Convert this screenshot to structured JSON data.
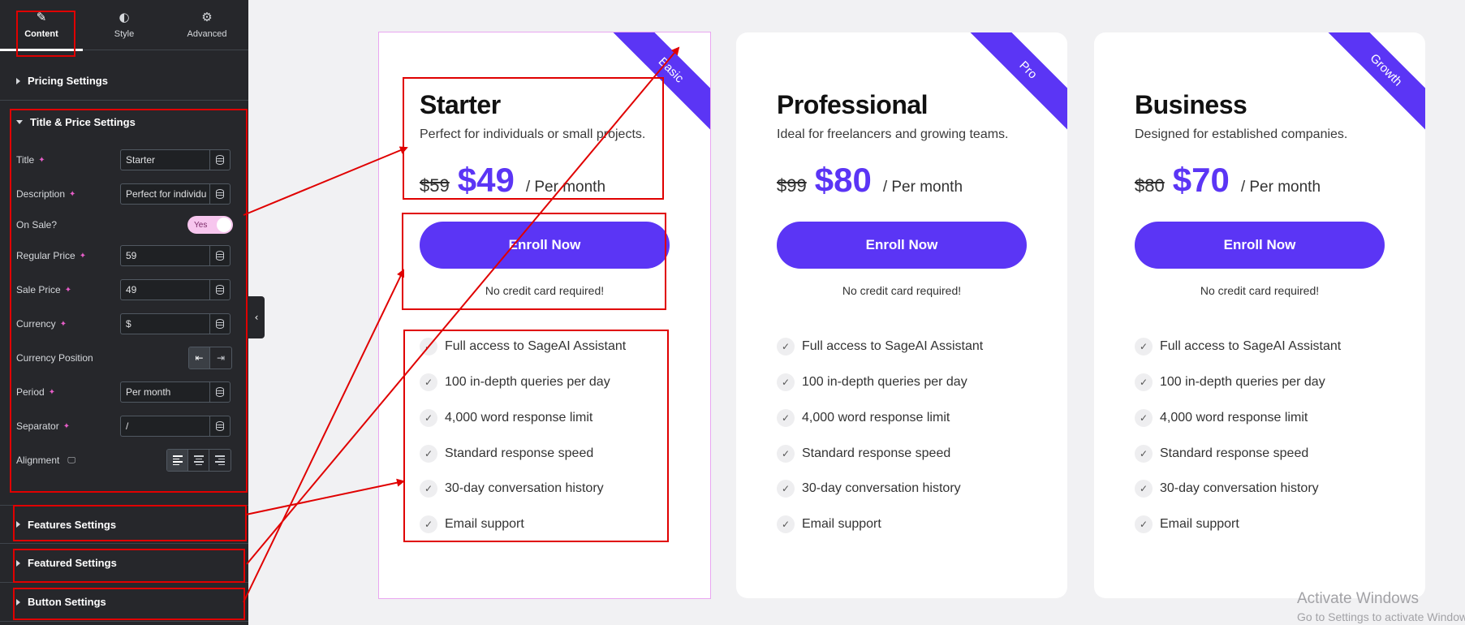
{
  "panel": {
    "tabs": [
      {
        "label": "Content",
        "icon": "pencil-icon"
      },
      {
        "label": "Style",
        "icon": "contrast-icon"
      },
      {
        "label": "Advanced",
        "icon": "gear-icon"
      }
    ],
    "sections": {
      "pricing": "Pricing Settings",
      "title_price": "Title & Price Settings",
      "features": "Features Settings",
      "featured": "Featured Settings",
      "button": "Button Settings"
    },
    "controls": {
      "title": {
        "label": "Title",
        "value": "Starter"
      },
      "description": {
        "label": "Description",
        "value": "Perfect for individu"
      },
      "on_sale": {
        "label": "On Sale?",
        "value": "Yes"
      },
      "regular_price": {
        "label": "Regular Price",
        "value": "59"
      },
      "sale_price": {
        "label": "Sale Price",
        "value": "49"
      },
      "currency": {
        "label": "Currency",
        "value": "$"
      },
      "currency_position": {
        "label": "Currency Position"
      },
      "period": {
        "label": "Period",
        "value": "Per month"
      },
      "separator": {
        "label": "Separator",
        "value": "/"
      },
      "alignment": {
        "label": "Alignment"
      }
    }
  },
  "cards": [
    {
      "badge": "Basic",
      "title": "Starter",
      "description": "Perfect for individuals or small projects.",
      "currency": "$",
      "regular_price": "59",
      "sale_price": "49",
      "period": "/ Per month",
      "button": "Enroll Now",
      "note": "No credit card required!",
      "features": [
        "Full access to SageAI Assistant",
        "100 in-depth queries per day",
        "4,000 word response limit",
        "Standard response speed",
        "30-day conversation history",
        "Email support"
      ]
    },
    {
      "badge": "Pro",
      "title": "Professional",
      "description": "Ideal for freelancers and growing teams.",
      "currency": "$",
      "regular_price": "99",
      "sale_price": "80",
      "period": "/ Per month",
      "button": "Enroll Now",
      "note": "No credit card required!",
      "features": [
        "Full access to SageAI Assistant",
        "100 in-depth queries per day",
        "4,000 word response limit",
        "Standard response speed",
        "30-day conversation history",
        "Email support"
      ]
    },
    {
      "badge": "Growth",
      "title": "Business",
      "description": "Designed for established companies.",
      "currency": "$",
      "regular_price": "80",
      "sale_price": "70",
      "period": "/ Per month",
      "button": "Enroll Now",
      "note": "No credit card required!",
      "features": [
        "Full access to SageAI Assistant",
        "100 in-depth queries per day",
        "4,000 word response limit",
        "Standard response speed",
        "30-day conversation history",
        "Email support"
      ]
    }
  ],
  "watermark": {
    "line1": "Activate Windows",
    "line2": "Go to Settings to activate Windows."
  },
  "colors": {
    "accent": "#5b35f5",
    "panel_bg": "#26272b",
    "annotation": "#e00000",
    "canvas_bg": "#f1f1f3"
  }
}
